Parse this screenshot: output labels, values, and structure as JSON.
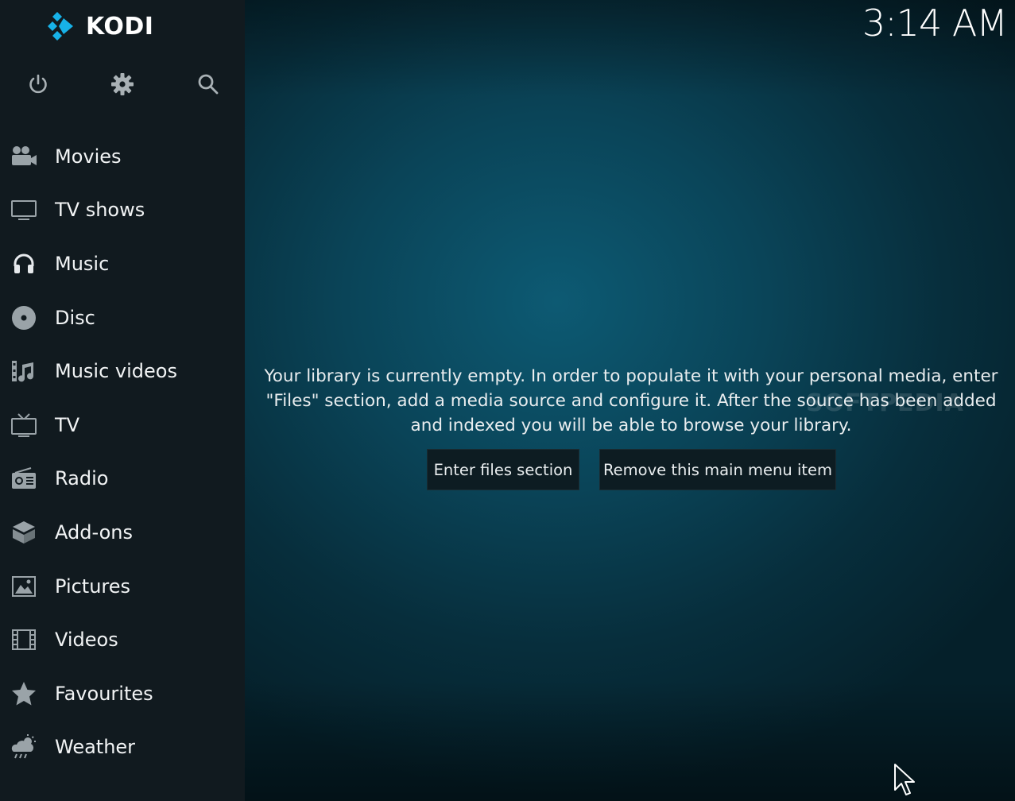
{
  "app": {
    "logo_text": "KODI",
    "clock": "3:14 AM"
  },
  "top_icons": [
    {
      "name": "power-icon"
    },
    {
      "name": "settings-icon"
    },
    {
      "name": "search-icon"
    }
  ],
  "menu": {
    "items": [
      {
        "label": "Movies",
        "icon": "movies-icon"
      },
      {
        "label": "TV shows",
        "icon": "tv-shows-icon"
      },
      {
        "label": "Music",
        "icon": "headphones-icon"
      },
      {
        "label": "Disc",
        "icon": "disc-icon"
      },
      {
        "label": "Music videos",
        "icon": "music-videos-icon"
      },
      {
        "label": "TV",
        "icon": "tv-icon"
      },
      {
        "label": "Radio",
        "icon": "radio-icon"
      },
      {
        "label": "Add-ons",
        "icon": "addons-icon"
      },
      {
        "label": "Pictures",
        "icon": "pictures-icon"
      },
      {
        "label": "Videos",
        "icon": "videos-icon"
      },
      {
        "label": "Favourites",
        "icon": "star-icon"
      },
      {
        "label": "Weather",
        "icon": "weather-icon"
      }
    ]
  },
  "main": {
    "message_line1": "Your library is currently empty. In order to populate it with your personal media, enter",
    "message_line2": "\"Files\" section, add a media source and configure it. After the source has been added",
    "message_line3": "and indexed you will be able to browse your library.",
    "enter_files_label": "Enter files section",
    "remove_item_label": "Remove this main menu item"
  },
  "watermark": "SOFTPEDIA",
  "colors": {
    "sidebar_bg": "#111a1f",
    "accent": "#12b2e7",
    "icon": "#9aa3a8"
  }
}
